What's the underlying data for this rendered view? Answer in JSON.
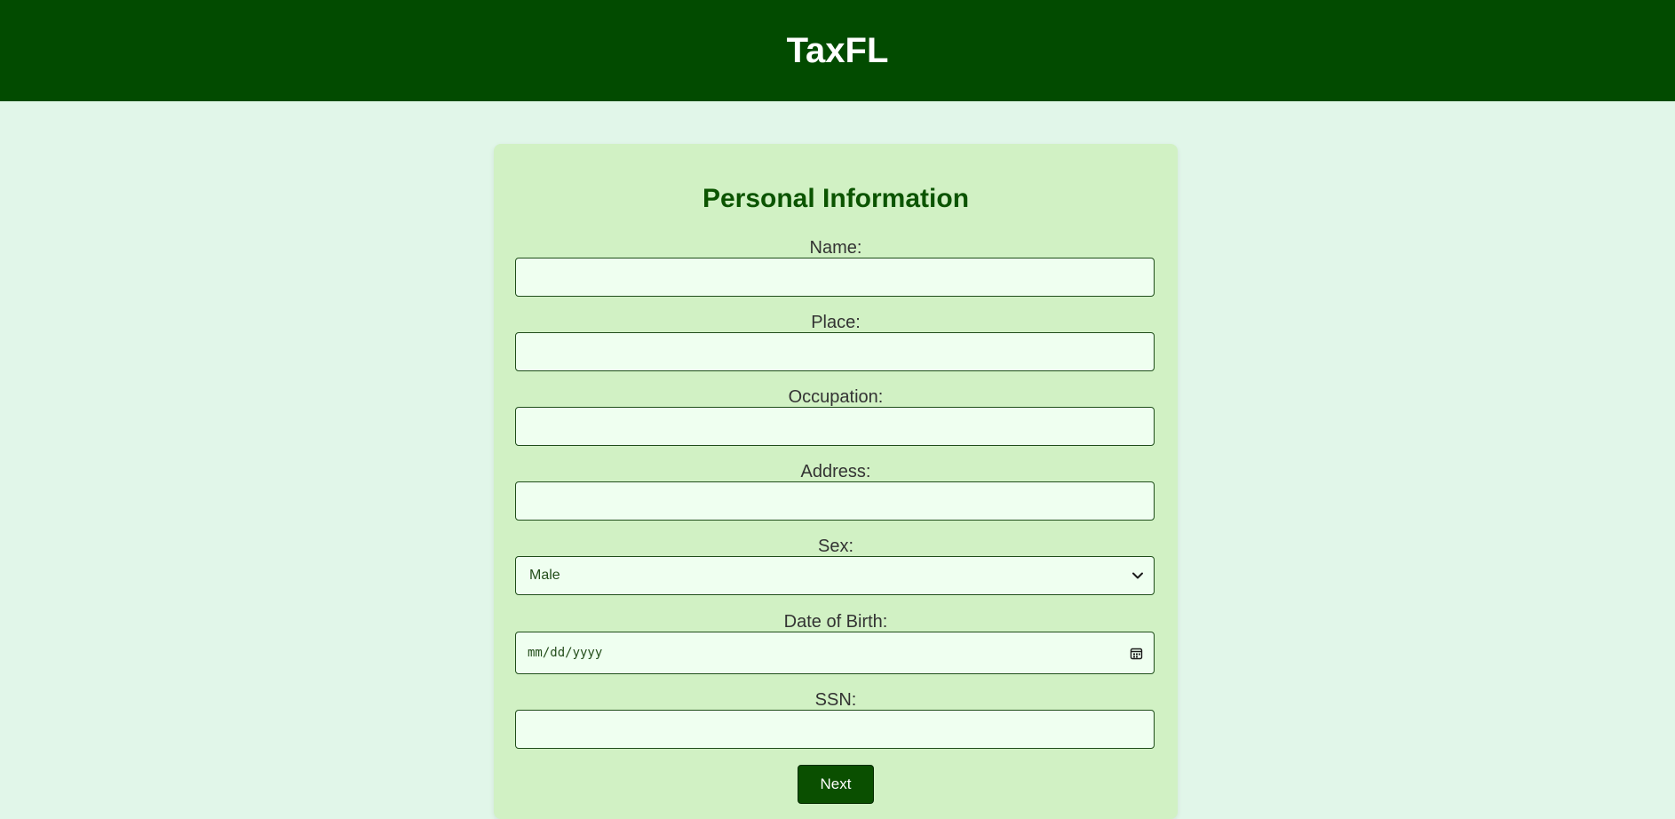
{
  "header": {
    "title": "TaxFL"
  },
  "form": {
    "title": "Personal Information",
    "fields": {
      "name": {
        "label": "Name:",
        "value": "",
        "placeholder": ""
      },
      "place": {
        "label": "Place:",
        "value": "",
        "placeholder": ""
      },
      "occupation": {
        "label": "Occupation:",
        "value": "",
        "placeholder": ""
      },
      "address": {
        "label": "Address:",
        "value": "",
        "placeholder": ""
      },
      "sex": {
        "label": "Sex:",
        "selected": "Male",
        "icon": "chevron-down-icon"
      },
      "dob": {
        "label": "Date of Birth:",
        "placeholder": "mm/dd/yyyy",
        "icon": "calendar-icon"
      },
      "ssn": {
        "label": "SSN:",
        "value": "",
        "placeholder": ""
      }
    },
    "next_label": "Next"
  },
  "colors": {
    "header_bg": "#024b00",
    "page_bg": "#e1f6e9",
    "card_bg": "#d1f1c4",
    "input_bg": "#effff0",
    "title_color": "#0b5400",
    "button_bg": "#0a4f00"
  }
}
